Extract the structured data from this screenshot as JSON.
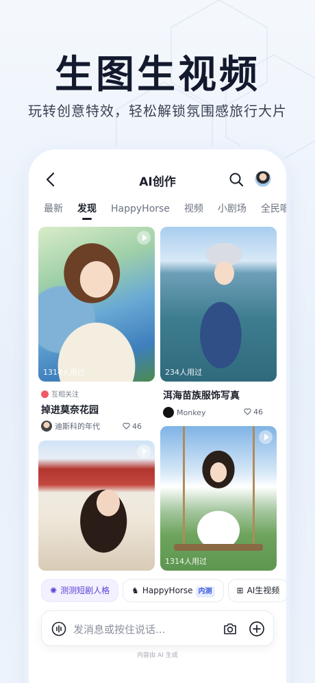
{
  "hero": {
    "title": "生图生视频",
    "subtitle": "玩转创意特效，轻松解锁氛围感旅行大片"
  },
  "app": {
    "title": "AI创作",
    "tabs": [
      "最新",
      "发现",
      "HappyHorse",
      "视频",
      "小剧场",
      "全民唱"
    ],
    "active_tab": "发现"
  },
  "feed": {
    "card1": {
      "usage": "1314人用过",
      "tag": "互相关注",
      "title": "掉进莫奈花园",
      "author": "迪斯科的年代",
      "likes": "46"
    },
    "card2": {
      "usage": "234人用过",
      "title": "洱海苗族服饰写真",
      "author": "Monkey",
      "likes": "46"
    },
    "card3": {},
    "card4": {
      "usage": "1314人用过"
    }
  },
  "chips": {
    "chip1": "测测短剧人格",
    "chip2": "HappyHorse",
    "chip2_badge": "内测",
    "chip3": "AI生视频"
  },
  "input": {
    "placeholder": "发消息或按住说话..."
  },
  "footnote": "内容由 AI 生成",
  "colors": {
    "accent": "#5b3fd6",
    "like_badge": "#f05a64",
    "badge_blue": "#3b5bdb"
  }
}
